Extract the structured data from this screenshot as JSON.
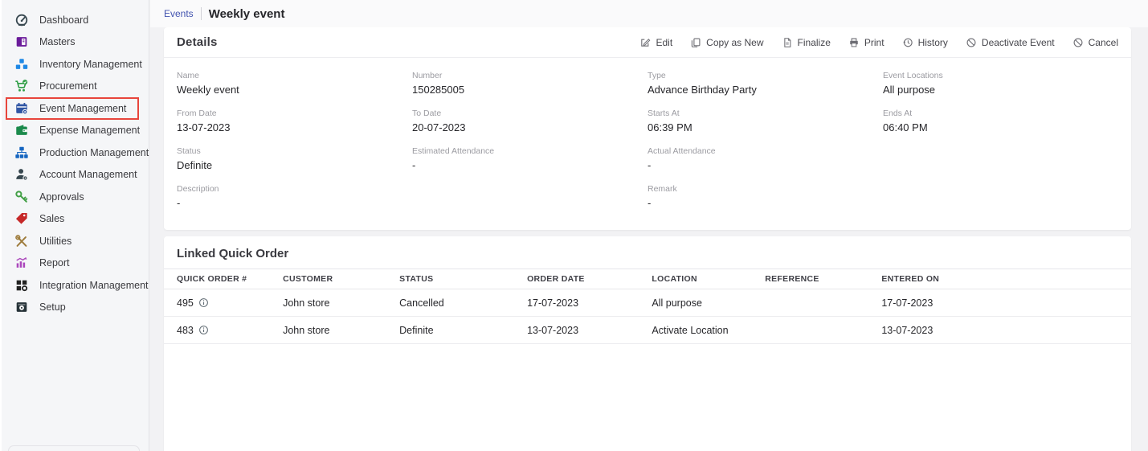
{
  "breadcrumb": {
    "parent": "Events",
    "title": "Weekly event"
  },
  "sidebar": {
    "highlight_color": "#e8453c",
    "items": [
      {
        "label": "Dashboard",
        "icon": "dashboard-gauge-icon",
        "color": "#37474f",
        "selected": false
      },
      {
        "label": "Masters",
        "icon": "masters-book-icon",
        "color": "#6a1b9a",
        "selected": false
      },
      {
        "label": "Inventory Management",
        "icon": "inventory-cubes-icon",
        "color": "#1e88e5",
        "selected": false
      },
      {
        "label": "Procurement",
        "icon": "procurement-cart-icon",
        "color": "#2e9e44",
        "selected": false
      },
      {
        "label": "Event Management",
        "icon": "event-calendar-icon",
        "color": "#2f55a4",
        "selected": true
      },
      {
        "label": "Expense Management",
        "icon": "expense-wallet-icon",
        "color": "#1b8a4c",
        "selected": false
      },
      {
        "label": "Production Management",
        "icon": "production-sitemap-icon",
        "color": "#1565c0",
        "selected": false
      },
      {
        "label": "Account Management",
        "icon": "account-person-icon",
        "color": "#37474f",
        "selected": false
      },
      {
        "label": "Approvals",
        "icon": "approvals-key-icon",
        "color": "#43a047",
        "selected": false
      },
      {
        "label": "Sales",
        "icon": "sales-tag-icon",
        "color": "#c62828",
        "selected": false
      },
      {
        "label": "Utilities",
        "icon": "utilities-tools-icon",
        "color": "#9e7c3c",
        "selected": false
      },
      {
        "label": "Report",
        "icon": "report-chart-icon",
        "color": "#ab47bc",
        "selected": false
      },
      {
        "label": "Integration Management",
        "icon": "integration-grid-icon",
        "color": "#212121",
        "selected": false
      },
      {
        "label": "Setup",
        "icon": "setup-box-icon",
        "color": "#263238",
        "selected": false
      }
    ]
  },
  "details": {
    "title": "Details",
    "toolbar": {
      "buttons": [
        {
          "label": "Edit",
          "icon": "edit-icon"
        },
        {
          "label": "Copy as New",
          "icon": "copy-icon"
        },
        {
          "label": "Finalize",
          "icon": "finalize-document-icon"
        },
        {
          "label": "Print",
          "icon": "print-icon"
        },
        {
          "label": "History",
          "icon": "history-clock-icon"
        },
        {
          "label": "Deactivate Event",
          "icon": "ban-icon"
        },
        {
          "label": "Cancel",
          "icon": "ban-icon"
        }
      ]
    },
    "fields": [
      {
        "label": "Name",
        "value": "Weekly event"
      },
      {
        "label": "Number",
        "value": "150285005"
      },
      {
        "label": "Type",
        "value": "Advance Birthday Party"
      },
      {
        "label": "Event Locations",
        "value": "All purpose"
      },
      {
        "label": "From Date",
        "value": "13-07-2023"
      },
      {
        "label": "To Date",
        "value": "20-07-2023"
      },
      {
        "label": "Starts At",
        "value": "06:39 PM"
      },
      {
        "label": "Ends At",
        "value": "06:40 PM"
      },
      {
        "label": "Status",
        "value": "Definite"
      },
      {
        "label": "Estimated Attendance",
        "value": "-"
      },
      {
        "label": "Actual Attendance",
        "value": "-"
      },
      {
        "label": "Description",
        "value": "-"
      },
      {
        "label": "Remark",
        "value": "-"
      }
    ]
  },
  "linked_quick_order": {
    "title": "Linked Quick Order",
    "columns": [
      "QUICK ORDER #",
      "CUSTOMER",
      "STATUS",
      "ORDER DATE",
      "LOCATION",
      "REFERENCE",
      "ENTERED ON"
    ],
    "rows": [
      {
        "quick_order": "495",
        "customer": "John store",
        "status": "Cancelled",
        "order_date": "17-07-2023",
        "location": "All purpose",
        "reference": "",
        "entered_on": "17-07-2023"
      },
      {
        "quick_order": "483",
        "customer": "John store",
        "status": "Definite",
        "order_date": "13-07-2023",
        "location": "Activate Location",
        "reference": "",
        "entered_on": "13-07-2023"
      }
    ]
  }
}
